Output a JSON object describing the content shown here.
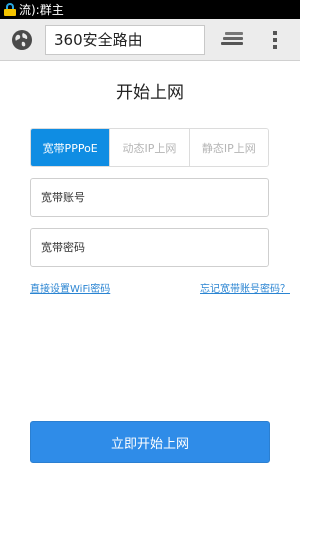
{
  "status_bar": {
    "text": "流):群主",
    "icon": "lock-icon"
  },
  "browser": {
    "url": "360安全路由",
    "icons": [
      "globe-icon",
      "tabs-icon",
      "overflow-menu-icon"
    ]
  },
  "page": {
    "title": "开始上网",
    "tabs": [
      {
        "label": "宽带PPPoE",
        "active": true
      },
      {
        "label": "动态IP上网",
        "active": false
      },
      {
        "label": "静态IP上网",
        "active": false
      }
    ],
    "account_field": {
      "placeholder": "宽带账号"
    },
    "password_field": {
      "placeholder": "宽带密码"
    },
    "link_wifi": "直接设置WiFi密码",
    "link_forgot": "忘记宽带账号密码？",
    "submit": "立即开始上网"
  },
  "colors": {
    "accent": "#0f8de3",
    "button": "#2f8ce8",
    "link": "#2a84d2"
  }
}
